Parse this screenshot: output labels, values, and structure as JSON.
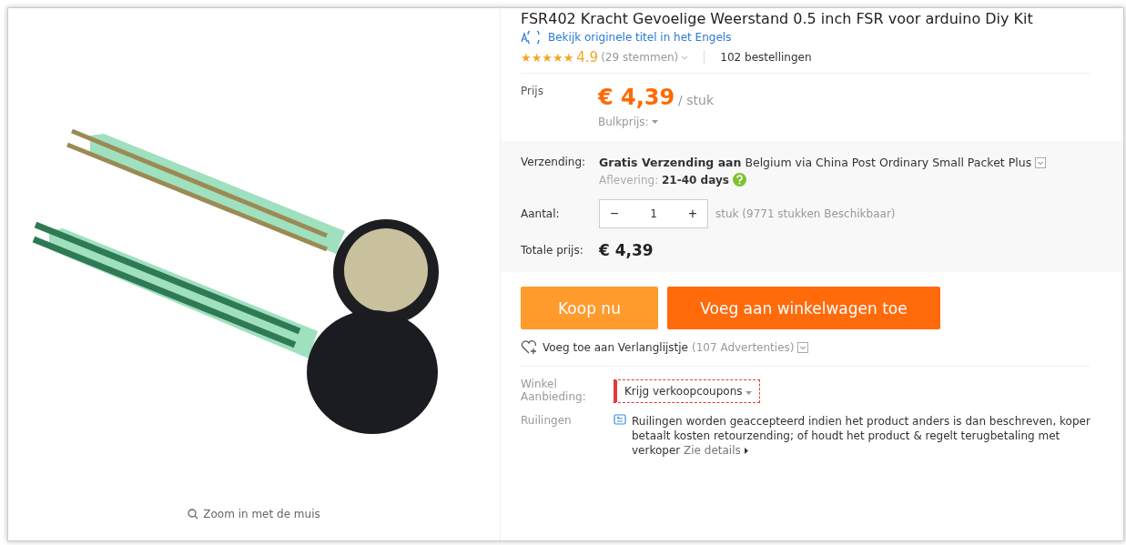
{
  "product_image": {
    "zoom_hint": "Zoom in met de muis"
  },
  "title": "FSR402 Kracht Gevoelige Weerstand 0.5 inch FSR voor arduino Diy Kit",
  "translate_link": "Bekijk originele titel in het Engels",
  "rating": {
    "stars": 5,
    "score": "4.9",
    "votes": "(29 stemmen)",
    "orders": "102 bestellingen"
  },
  "price": {
    "label": "Prijs",
    "value": "€ 4,39",
    "unit": "/ stuk",
    "bulk": "Bulkprijs:"
  },
  "shipping": {
    "label": "Verzending:",
    "free": "Gratis Verzending aan",
    "destination": "Belgium via China Post Ordinary Small Packet Plus",
    "delivery_label": "Aflevering:",
    "delivery": "21-40 days"
  },
  "quantity": {
    "label": "Aantal:",
    "minus": "−",
    "value": "1",
    "plus": "+",
    "note": "stuk (9771 stukken Beschikbaar)"
  },
  "total": {
    "label": "Totale prijs:",
    "value": "€ 4,39"
  },
  "buttons": [
    {
      "kind": "buy",
      "label": "Koop nu"
    },
    {
      "kind": "cart",
      "label": "Voeg aan winkelwagen toe"
    }
  ],
  "wishlist": {
    "label": "Voeg toe aan Verlanglijstje",
    "count": "(107 Advertenties)"
  },
  "store_offer": {
    "label": "Winkel Aanbieding:",
    "coupon": "Krijg verkoopcoupons"
  },
  "returns": {
    "label": "Ruilingen",
    "text": "Ruilingen worden geaccepteerd indien het product anders is dan beschreven, koper betaalt kosten retourzending; of houdt het product & regelt terugbetaling met verkoper",
    "link": "Zie details"
  }
}
